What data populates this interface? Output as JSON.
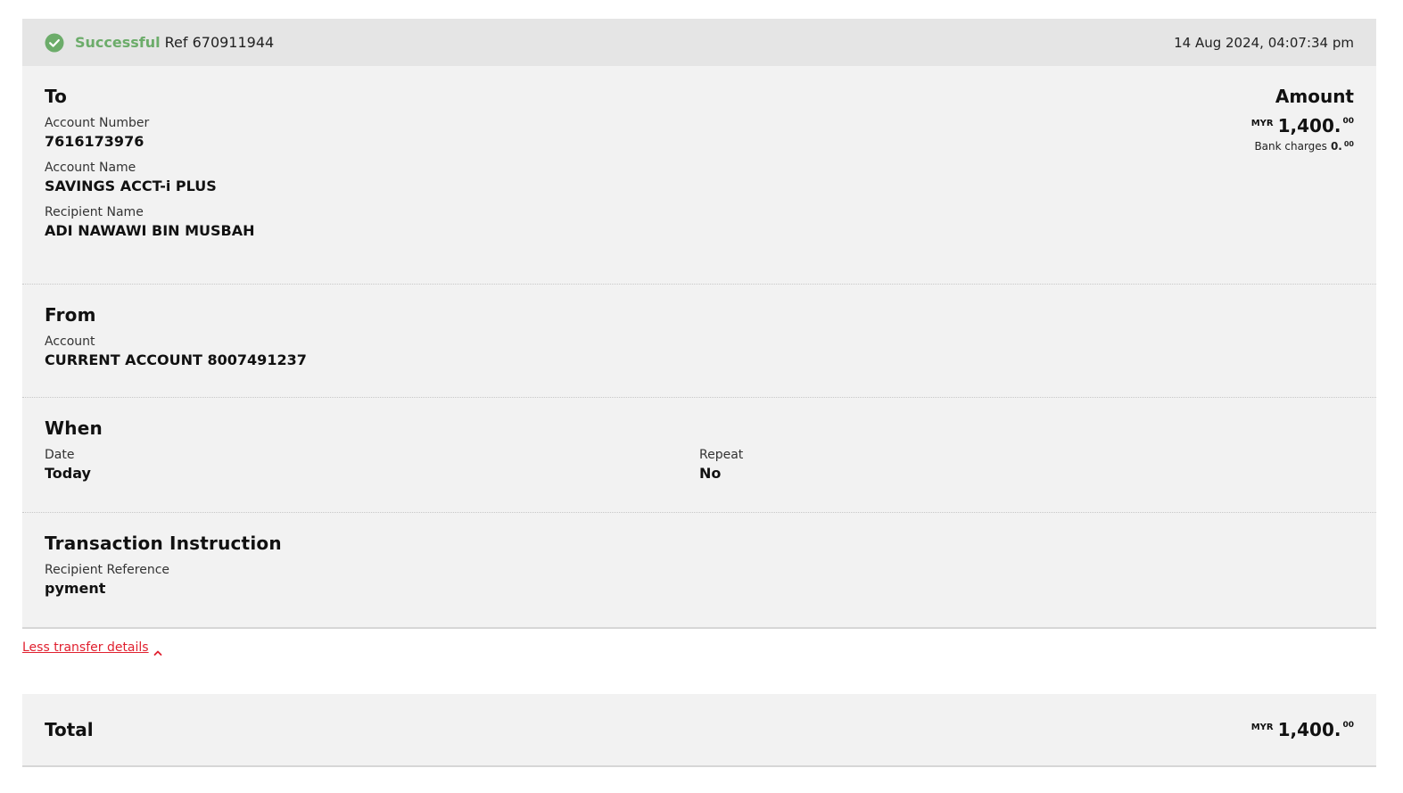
{
  "status": {
    "label": "Successful",
    "ref": "Ref 670911944",
    "timestamp": "14 Aug 2024, 04:07:34 pm",
    "color": "#6cac6a"
  },
  "to": {
    "title": "To",
    "fields": [
      {
        "label": "Account Number",
        "value": "7616173976"
      },
      {
        "label": "Account Name",
        "value": "SAVINGS ACCT-i PLUS"
      },
      {
        "label": "Recipient Name",
        "value": "ADI NAWAWI BIN MUSBAH"
      }
    ]
  },
  "amount": {
    "title": "Amount",
    "currency": "MYR",
    "whole": "1,400.",
    "cents": "00",
    "bank_charges_label": "Bank charges",
    "bank_charges_whole": "0.",
    "bank_charges_cents": "00"
  },
  "from": {
    "title": "From",
    "fields": [
      {
        "label": "Account",
        "value": "CURRENT ACCOUNT 8007491237"
      }
    ]
  },
  "when": {
    "title": "When",
    "date_label": "Date",
    "date_value": "Today",
    "repeat_label": "Repeat",
    "repeat_value": "No"
  },
  "instruction": {
    "title": "Transaction Instruction",
    "fields": [
      {
        "label": "Recipient Reference",
        "value": "pyment"
      }
    ]
  },
  "toggle_link": {
    "label": "Less transfer details",
    "icon": "chevron-up-icon",
    "color": "#e0202f"
  },
  "total": {
    "label": "Total",
    "currency": "MYR",
    "whole": "1,400.",
    "cents": "00"
  }
}
